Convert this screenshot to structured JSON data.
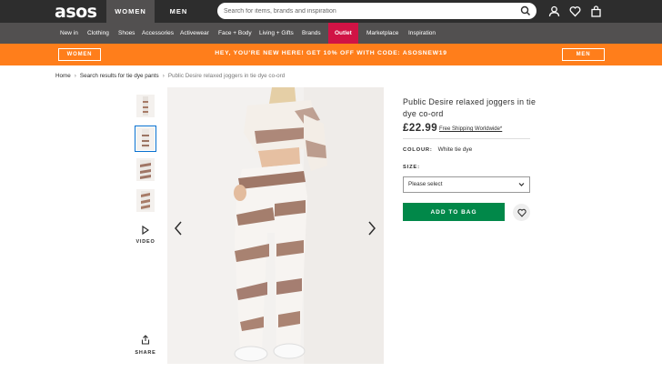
{
  "header": {
    "logo": "asos",
    "tabs": [
      {
        "label": "WOMEN",
        "active": true
      },
      {
        "label": "MEN",
        "active": false
      }
    ],
    "search_placeholder": "Search for items, brands and inspiration",
    "icons": [
      "account-icon",
      "heart-icon",
      "bag-icon"
    ]
  },
  "category_nav": {
    "items": [
      "New in",
      "Clothing",
      "Shoes",
      "Accessories",
      "Activewear",
      "Face + Body",
      "Living + Gifts",
      "Brands",
      "Outlet",
      "Marketplace",
      "Inspiration"
    ],
    "highlight_color": "#d01345"
  },
  "promo": {
    "left_button": "WOMEN",
    "message": "HEY, YOU'RE NEW HERE! GET 10% OFF WITH CODE: ASOSNEW19",
    "right_button": "MEN",
    "color": "#ff7e1b"
  },
  "breadcrumb": [
    "Home",
    "Search results for tie dye pants",
    "Public Desire relaxed joggers in tie dye co-ord"
  ],
  "gallery": {
    "thumbnail_count": 4,
    "selected_thumbnail": 2,
    "video_label": "VIDEO",
    "share_label": "SHARE"
  },
  "product": {
    "title": "Public Desire relaxed joggers in tie dye co-ord",
    "price": "£22.99",
    "shipping_link": "Free Shipping Worldwide*",
    "colour_label": "COLOUR:",
    "colour_value": "White tie dye",
    "size_label": "SIZE:",
    "size_selected": "Please select",
    "add_to_bag": "ADD TO BAG",
    "add_color": "#018849"
  }
}
